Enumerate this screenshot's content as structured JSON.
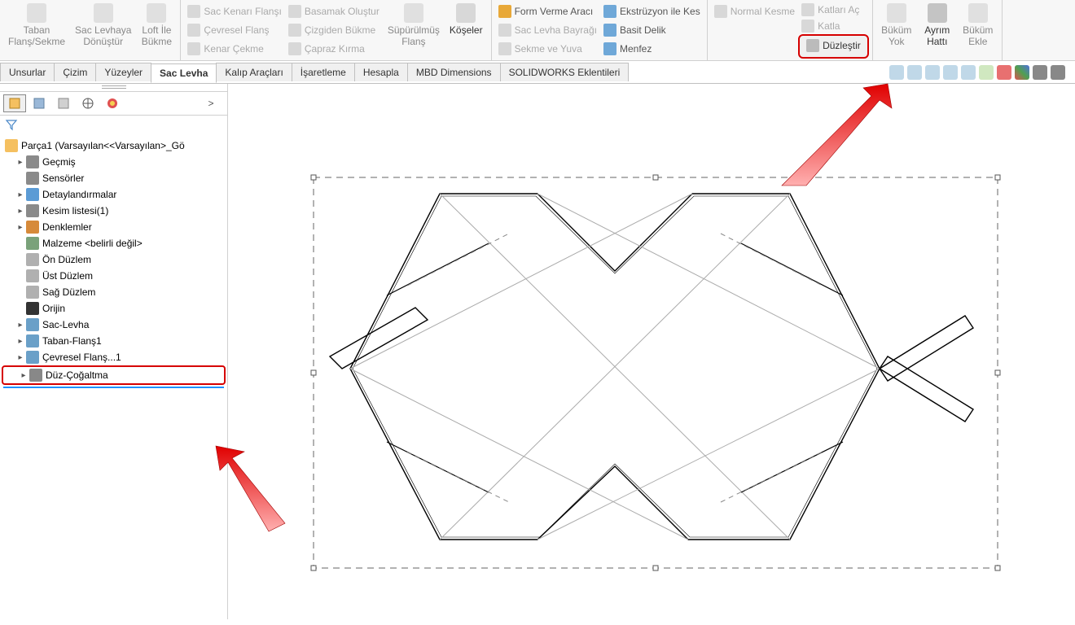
{
  "ribbon": {
    "group1": {
      "taban_flans": "Taban\nFlanş/Sekme",
      "sac_levhaya": "Sac Levhaya\nDönüştür",
      "loft_ile": "Loft İle\nBükme"
    },
    "group2": {
      "sac_kenari": "Sac Kenarı Flanşı",
      "cevresel": "Çevresel Flanş",
      "kenar_cekme": "Kenar Çekme",
      "basamak": "Basamak Oluştur",
      "cizgiden": "Çizgiden Bükme",
      "capraz": "Çapraz Kırma",
      "supurulmus": "Süpürülmüş\nFlanş",
      "koseler": "Köşeler"
    },
    "group3": {
      "form_verme": "Form Verme Aracı",
      "sac_levha_bayragi": "Sac Levha Bayrağı",
      "sekme_yuva": "Sekme ve Yuva",
      "ekstruzyon": "Ekstrüzyon ile Kes",
      "basit_delik": "Basit Delik",
      "menfez": "Menfez"
    },
    "group4": {
      "normal_kesme": "Normal Kesme",
      "katlari_ac": "Katları Aç",
      "katla": "Katla",
      "duzlestir": "Düzleştir"
    },
    "group5": {
      "bukum_yok": "Büküm\nYok",
      "ayrim_hatti": "Ayrım\nHattı",
      "bukum_ekle": "Büküm\nEkle"
    }
  },
  "tabs": {
    "unsurlar": "Unsurlar",
    "cizim": "Çizim",
    "yuzeyler": "Yüzeyler",
    "sac_levha": "Sac Levha",
    "kalip": "Kalıp Araçları",
    "isaretleme": "İşaretleme",
    "hesapla": "Hesapla",
    "mbd": "MBD Dimensions",
    "eklentiler": "SOLIDWORKS Eklentileri"
  },
  "tree": {
    "root": "Parça1  (Varsayılan<<Varsayılan>_Gö",
    "items": [
      {
        "label": "Geçmiş",
        "icon": "#8a8a8a",
        "caret": true
      },
      {
        "label": "Sensörler",
        "icon": "#8a8a8a",
        "caret": false
      },
      {
        "label": "Detaylandırmalar",
        "icon": "#5b9bd5",
        "caret": true
      },
      {
        "label": "Kesim listesi(1)",
        "icon": "#8a8a8a",
        "caret": true
      },
      {
        "label": "Denklemler",
        "icon": "#d68a3a",
        "caret": true
      },
      {
        "label": "Malzeme <belirli değil>",
        "icon": "#7aa27a",
        "caret": false
      },
      {
        "label": "Ön Düzlem",
        "icon": "#b0b0b0",
        "caret": false
      },
      {
        "label": "Üst Düzlem",
        "icon": "#b0b0b0",
        "caret": false
      },
      {
        "label": "Sağ Düzlem",
        "icon": "#b0b0b0",
        "caret": false
      },
      {
        "label": "Orijin",
        "icon": "#333",
        "caret": false
      },
      {
        "label": "Sac-Levha",
        "icon": "#6aa0c8",
        "caret": true
      },
      {
        "label": "Taban-Flanş1",
        "icon": "#6aa0c8",
        "caret": true
      },
      {
        "label": "Çevresel Flanş...1",
        "icon": "#6aa0c8",
        "caret": true
      },
      {
        "label": "Düz-Çoğaltma",
        "icon": "#888",
        "caret": true
      }
    ]
  }
}
